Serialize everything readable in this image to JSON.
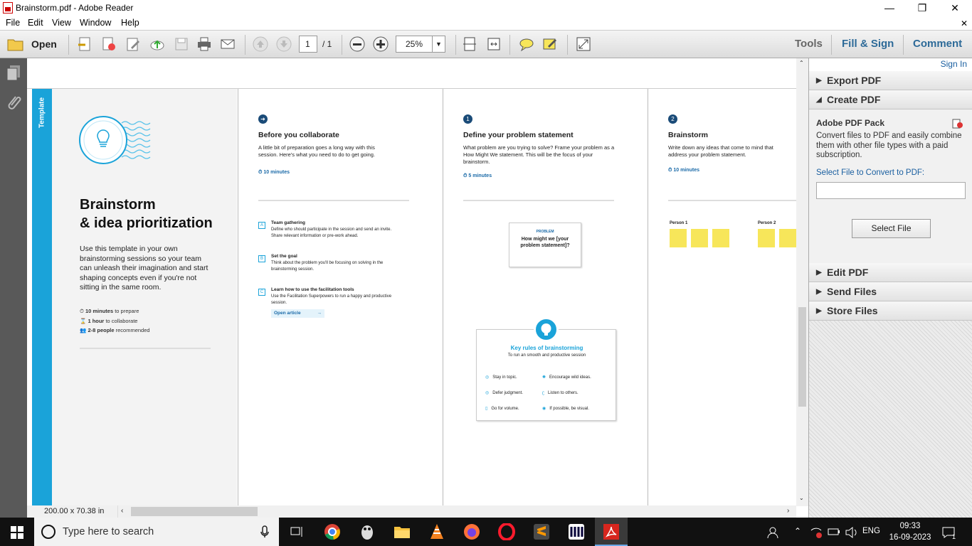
{
  "window": {
    "title": "Brainstorm.pdf - Adobe Reader",
    "minimize": "—",
    "restore": "❐",
    "close": "✕"
  },
  "menu": [
    "File",
    "Edit",
    "View",
    "Window",
    "Help"
  ],
  "menu_close": "✕",
  "toolbar": {
    "open_label": "Open",
    "page_current": "1",
    "page_total": "/ 1",
    "zoom": "25%",
    "tools": "Tools",
    "fill_sign": "Fill & Sign",
    "comment": "Comment"
  },
  "right_panel": {
    "sign_in": "Sign In",
    "export_pdf": "Export PDF",
    "create_pdf": "Create PDF",
    "pack_title": "Adobe PDF Pack",
    "pack_desc": "Convert files to PDF and easily combine them with other file types with a paid subscription.",
    "select_label": "Select File to Convert to PDF:",
    "select_button": "Select File",
    "edit_pdf": "Edit PDF",
    "send_files": "Send Files",
    "store_files": "Store Files"
  },
  "status": {
    "page_size": "200.00 x 70.38 in"
  },
  "document": {
    "sidebar_tab": "Template",
    "main_title_1": "Brainstorm",
    "main_title_2": "& idea prioritization",
    "intro": "Use this template in your own brainstorming sessions so your team can unleash their imagination and start shaping concepts even if you're not sitting in the same room.",
    "meta": [
      {
        "bold": "10 minutes",
        "text": " to prepare"
      },
      {
        "bold": "1 hour",
        "text": " to collaborate"
      },
      {
        "bold": "2-8 people",
        "text": " recommended"
      }
    ],
    "col1": {
      "badge": "➜",
      "title": "Before you collaborate",
      "desc": "A little bit of preparation goes a long way with this session. Here's what you need to do to get going.",
      "time": "10 minutes",
      "steps": [
        {
          "letter": "A",
          "title": "Team gathering",
          "desc": "Define who should participate in the session and send an invite. Share relevant information or pre-work ahead."
        },
        {
          "letter": "B",
          "title": "Set the goal",
          "desc": "Think about the problem you'll be focusing on solving in the brainstorming session."
        },
        {
          "letter": "C",
          "title": "Learn how to use the facilitation tools",
          "desc": "Use the Facilitation Superpowers to run a happy and productive session."
        }
      ],
      "link": "Open article"
    },
    "col2": {
      "badge": "1",
      "title": "Define your problem statement",
      "desc": "What problem are you trying to solve? Frame your problem as a How Might We statement. This will be the focus of your brainstorm.",
      "time": "5 minutes",
      "card_label": "PROBLEM",
      "card_text": "How might we [your problem statement]?",
      "rules_title": "Key rules of brainstorming",
      "rules_sub": "To run an smooth and productive session",
      "rules": [
        "Stay in topic.",
        "Encourage wild ideas.",
        "Defer judgment.",
        "Listen to others.",
        "Go for volume.",
        "If possible, be visual."
      ]
    },
    "col3": {
      "badge": "2",
      "title": "Brainstorm",
      "desc": "Write down any ideas that come to mind that address your problem statement.",
      "time": "10 minutes",
      "person1": "Person 1",
      "person2": "Person 2"
    }
  },
  "taskbar": {
    "search": "Type here to search",
    "lang": "ENG",
    "time": "09:33",
    "date": "16-09-2023",
    "notif": "1"
  },
  "colors": {
    "accent": "#1aa3d9",
    "link": "#2d6a98",
    "sticky": "#f7e65a"
  }
}
